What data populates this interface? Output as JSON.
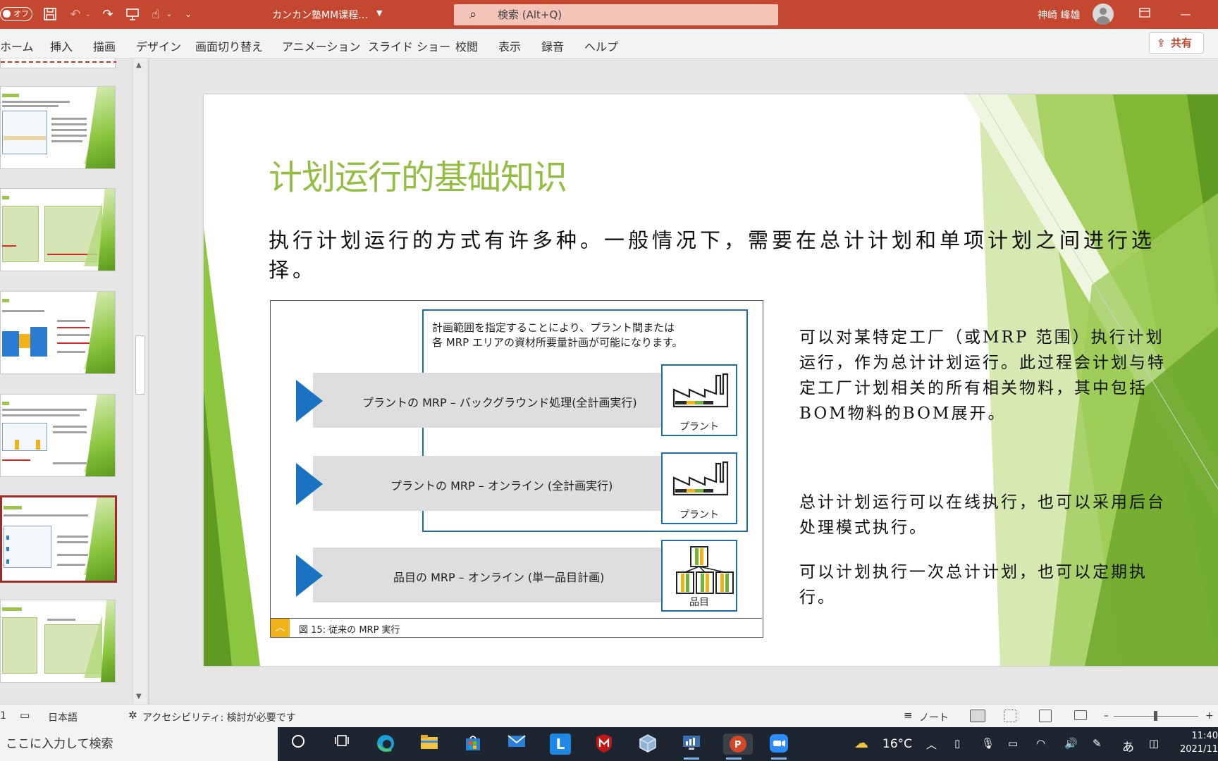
{
  "titlebar": {
    "autosave_label": "オフ",
    "doc_title": "カンカン塾MM课程…",
    "search_placeholder": "検索 (Alt+Q)",
    "user_name": "神崎 峰雄"
  },
  "ribbon": {
    "tabs": [
      "ホーム",
      "挿入",
      "描画",
      "デザイン",
      "画面切り替え",
      "アニメーション",
      "スライド ショー",
      "校閲",
      "表示",
      "録音",
      "ヘルプ"
    ],
    "share_label": "共有"
  },
  "slide": {
    "title": "计划运行的基础知识",
    "lead": "执行计划运行的方式有许多种。一般情况下，需要在总计计划和单项计划之间进行选择。",
    "diagram": {
      "note_line1": "計画範囲を指定することにより、プラント間または",
      "note_line2": "各 MRP エリアの資材所要量計画が可能になります。",
      "rows": [
        {
          "label": "プラントの MRP – バックグラウンド処理(全計画実行)",
          "icon_caption": "プラント"
        },
        {
          "label": "プラントの MRP – オンライン (全計画実行)",
          "icon_caption": "プラント"
        },
        {
          "label": "品目の MRP – オンライン (単一品目計画)",
          "icon_caption": "品目"
        }
      ],
      "caption": "図 15: 従来の MRP 実行"
    },
    "paragraphs": [
      "可以对某特定工厂（或MRP 范围）执行计划运行，作为总计计划运行。此过程会计划与特定工厂计划相关的所有相关物料，其中包括BOM物料的BOM展开。",
      "总计计划运行可以在线执行，也可以采用后台处理模式执行。",
      "可以计划执行一次总计计划，也可以定期执行。"
    ]
  },
  "statusbar": {
    "slide_num": "1",
    "language": "日本語",
    "accessibility": "アクセシビリティ: 検討が必要です",
    "notes": "ノート",
    "zoom_minus": "–",
    "zoom_plus": "+"
  },
  "taskbar": {
    "search_placeholder": "ここに入力して検索",
    "weather": "16°C",
    "ime": "あ",
    "time": "11:40",
    "date": "2021/11"
  },
  "colors": {
    "title_bar": "#c4472f",
    "slide_title": "#93be41",
    "diagram_blue": "#1a72c2",
    "selected_thumb": "#9e2a2a"
  },
  "icons": [
    "save-icon",
    "undo-icon",
    "redo-icon",
    "present-icon",
    "touch-icon",
    "search-icon",
    "share-icon",
    "factory-icon",
    "materials-icon",
    "spellcheck-icon",
    "accessibility-icon",
    "windows-search-icon",
    "task-view-icon",
    "edge-icon",
    "explorer-icon",
    "store-icon",
    "mail-icon",
    "powerpoint-icon",
    "zoom-icon"
  ]
}
